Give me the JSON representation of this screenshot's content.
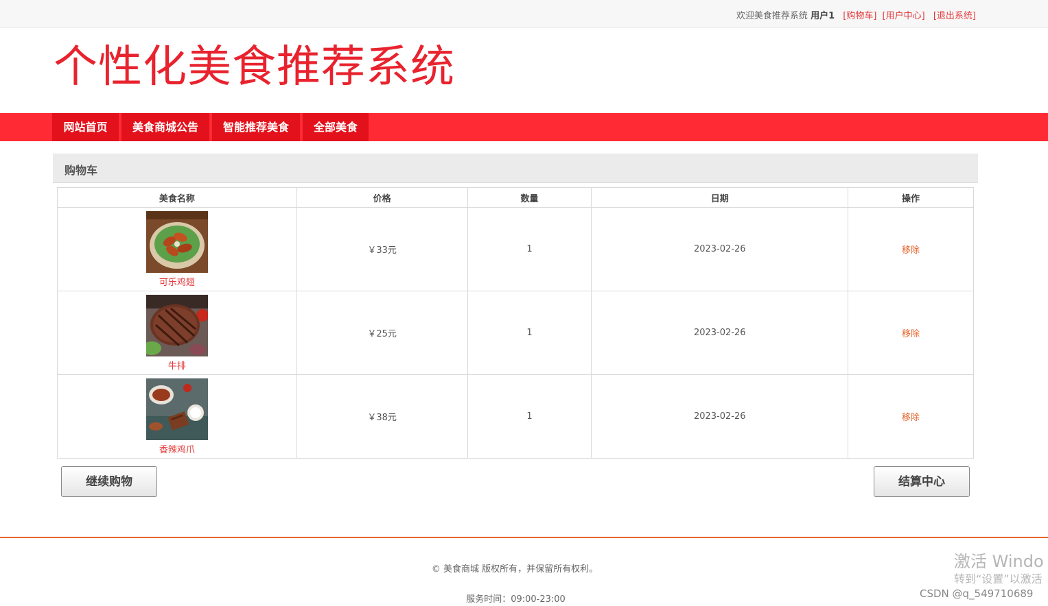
{
  "topbar": {
    "welcome": "欢迎美食推荐系统",
    "username": "用户1",
    "links": [
      "[购物车]",
      "[用户中心]",
      "[退出系统]"
    ]
  },
  "site_title": "个性化美食推荐系统",
  "nav": [
    "网站首页",
    "美食商城公告",
    "智能推荐美食",
    "全部美食"
  ],
  "cart": {
    "title": "购物车",
    "columns": [
      "美食名称",
      "价格",
      "数量",
      "日期",
      "操作"
    ],
    "rows": [
      {
        "name": "可乐鸡翅",
        "price": "￥33元",
        "qty": "1",
        "date": "2023-02-26",
        "action": "移除"
      },
      {
        "name": "牛排",
        "price": "￥25元",
        "qty": "1",
        "date": "2023-02-26",
        "action": "移除"
      },
      {
        "name": "香辣鸡爪",
        "price": "￥38元",
        "qty": "1",
        "date": "2023-02-26",
        "action": "移除"
      }
    ]
  },
  "buttons": {
    "continue": "继续购物",
    "checkout": "结算中心"
  },
  "footer": {
    "copyright": "© 美食商城 版权所有，并保留所有权利。",
    "service_time": "服务时间：09:00-23:00"
  },
  "overlay": {
    "activate_line1": "激活 Windo",
    "activate_line2": "转到“设置”以激活",
    "csdn": "CSDN @q_549710689"
  }
}
